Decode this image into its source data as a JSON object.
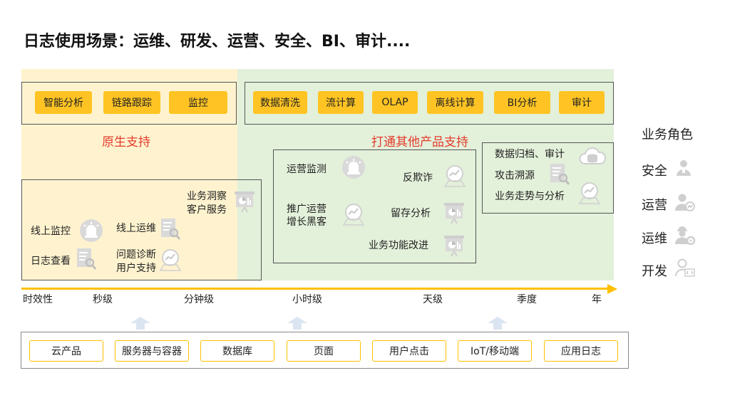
{
  "title": "日志使用场景：运维、研发、运营、安全、BI、审计....",
  "native_support": {
    "label": "原生支持",
    "capabilities": [
      "智能分析",
      "链路跟踪",
      "监控"
    ]
  },
  "integrated_support": {
    "label": "打通其他产品支持",
    "capabilities": [
      "数据清洗",
      "流计算",
      "OLAP",
      "离线计算",
      "BI分析",
      "审计"
    ]
  },
  "scenarios": {
    "online_monitoring": "线上监控",
    "online_ops": "线上运维",
    "log_view": "日志查看",
    "problem_diagnosis": "问题诊断",
    "user_support": "用户支持",
    "biz_insight": "业务洞察",
    "customer_service": "客户服务",
    "ops_monitoring": "运营监测",
    "anti_fraud": "反欺诈",
    "promo_ops": "推广运营",
    "growth_hacker": "增长黑客",
    "retention": "留存分析",
    "feature_improve": "业务功能改进",
    "data_archive": "数据归档、审计",
    "attack_trace": "攻击溯源",
    "trend_analysis": "业务走势与分析"
  },
  "timeline": {
    "label": "时效性",
    "ticks": [
      "秒级",
      "分钟级",
      "小时级",
      "天级",
      "季度",
      "年"
    ]
  },
  "sources": [
    "云产品",
    "服务器与容器",
    "数据库",
    "页面",
    "用户点击",
    "IoT/移动端",
    "应用日志"
  ],
  "roles": {
    "title": "业务角色",
    "items": [
      "安全",
      "运营",
      "运维",
      "开发"
    ]
  },
  "colors": {
    "accent": "#ffc423",
    "native_bg": "#fff3cf",
    "integrated_bg": "#e3f0da",
    "label_red": "#e53b2c"
  }
}
